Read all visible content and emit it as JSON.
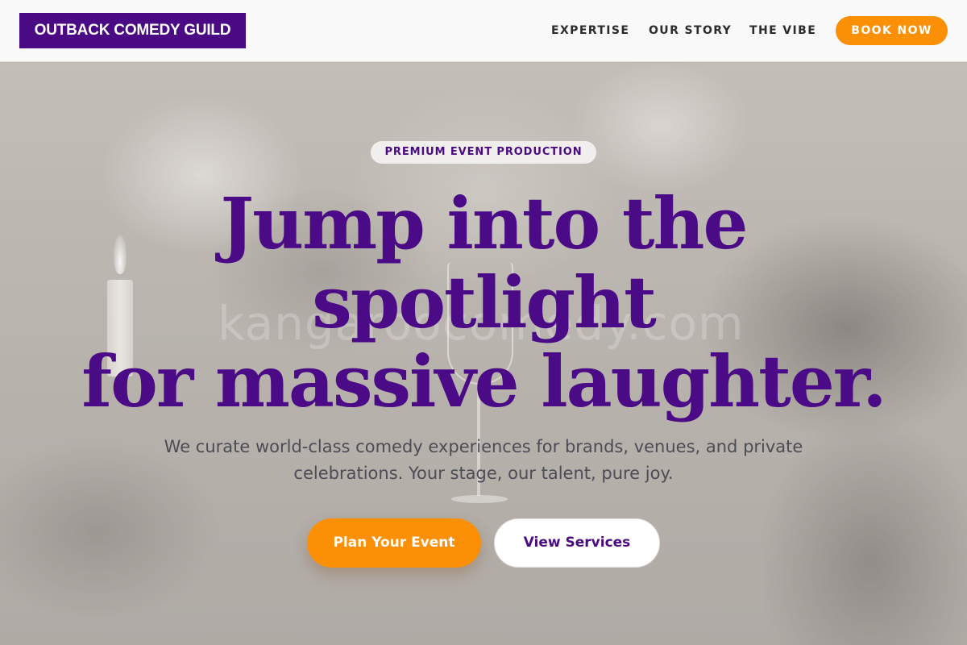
{
  "header": {
    "logo_text": "OUTBACK COMEDY GUILD",
    "nav": [
      {
        "label": "EXPERTISE"
      },
      {
        "label": "OUR STORY"
      },
      {
        "label": "THE VIBE"
      }
    ],
    "cta_label": "BOOK NOW"
  },
  "hero": {
    "watermark": "kangaroocomedy.com",
    "badge": "PREMIUM EVENT PRODUCTION",
    "headline_lines": [
      "Jump into the",
      "spotlight",
      "for massive laughter."
    ],
    "subtext": "We curate world-class comedy experiences for brands, venues, and private celebrations. Your stage, our talent, pure joy.",
    "primary_button": "Plan Your Event",
    "secondary_button": "View Services"
  },
  "colors": {
    "brand_purple": "#4a0a84",
    "accent_orange": "#fb8f06",
    "header_bg": "#f9f9f9",
    "body_text": "#4c4c55"
  }
}
